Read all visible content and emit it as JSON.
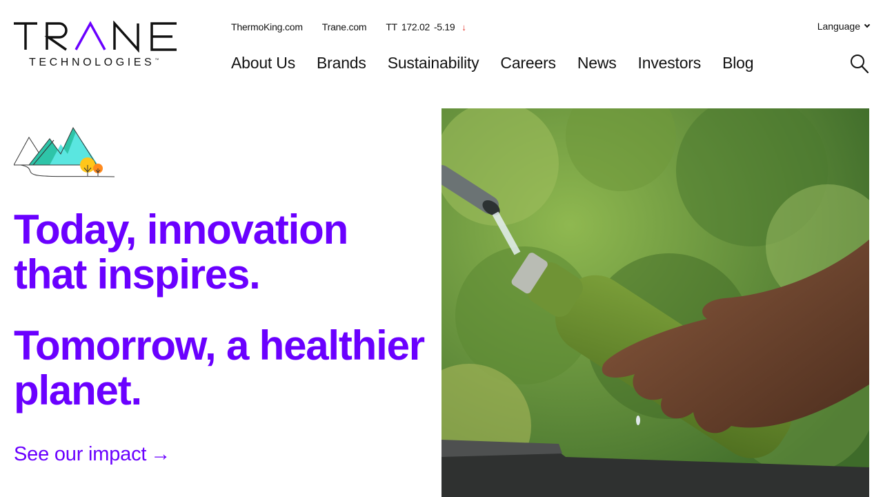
{
  "brand": {
    "logo_main": "TRANE",
    "logo_sub": "TECHNOLOGIES",
    "logo_tm": "™"
  },
  "utility": {
    "links": [
      "ThermoKing.com",
      "Trane.com"
    ],
    "ticker": {
      "symbol": "TT",
      "price": "172.02",
      "change": "-5.19",
      "direction": "down",
      "arrow": "↓"
    },
    "language_label": "Language"
  },
  "nav": {
    "items": [
      "About Us",
      "Brands",
      "Sustainability",
      "Careers",
      "News",
      "Investors",
      "Blog"
    ]
  },
  "icons": {
    "search": "search-icon",
    "language": "chevron-down-icon",
    "cta_arrow": "arrow-right-icon",
    "ticker_arrow": "arrow-down-icon"
  },
  "hero": {
    "headline_1": "Today, innovation that inspires.",
    "headline_2": "Tomorrow, a healthier planet.",
    "cta_label": "See our impact",
    "cta_arrow": "→"
  },
  "colors": {
    "accent": "#6a00ff",
    "ticker_down": "#e0281e",
    "text": "#111111"
  }
}
